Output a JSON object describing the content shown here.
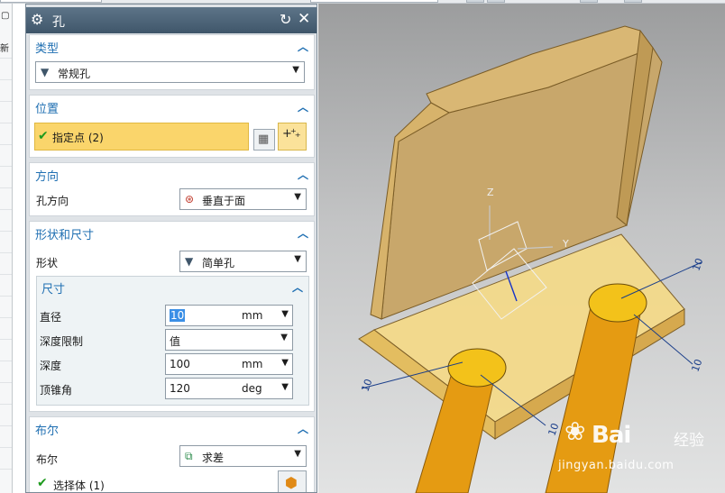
{
  "nav": {
    "icon": "▢",
    "label": "新"
  },
  "dialog": {
    "title": "孔",
    "title_icon": "gear-icon",
    "sections": {
      "type": {
        "title": "类型",
        "dropdown": "常规孔"
      },
      "position": {
        "title": "位置",
        "point_label": "指定点 (2)"
      },
      "direction": {
        "title": "方向",
        "label": "孔方向",
        "dropdown": "垂直于面"
      },
      "shape": {
        "title": "形状和尺寸",
        "shape_label": "形状",
        "shape_dropdown": "简单孔",
        "dims": {
          "title": "尺寸",
          "diameter_label": "直径",
          "diameter_value": "10",
          "diameter_unit": "mm",
          "depth_limit_label": "深度限制",
          "depth_limit_value": "值",
          "depth_label": "深度",
          "depth_value": "100",
          "depth_unit": "mm",
          "tip_label": "顶锥角",
          "tip_value": "120",
          "tip_unit": "deg"
        }
      },
      "boolean": {
        "title": "布尔",
        "label": "布尔",
        "dropdown": "求差",
        "select_body": "选择体 (1)"
      }
    }
  },
  "viewport": {
    "axis_z": "Z",
    "axis_y": "Y",
    "dims": {
      "d1": "10",
      "d2": "10",
      "d3": "10",
      "d4": "10"
    },
    "watermark": {
      "brand": "Bai   ",
      "brand_cn": "经验",
      "url": "jingyan.baidu.com"
    }
  },
  "colors": {
    "accent": "#1f6fb2",
    "titlebar": "#4a6074",
    "highlight": "#fad56b",
    "part": "#f4c85a"
  }
}
